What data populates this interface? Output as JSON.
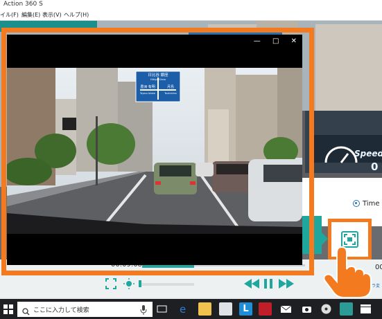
{
  "window": {
    "title": "Action 360 S"
  },
  "menu": {
    "items": [
      "イル(F)",
      "編集(E)",
      "表示(V)",
      "ヘルプ(H)"
    ]
  },
  "player": {
    "time": "00:09:08",
    "side_number": "00",
    "speed_label": "Speed",
    "speed_value": "0",
    "time_option_label": "Time",
    "small_label": "カメラ変換"
  },
  "video_window": {
    "controls": [
      "—",
      "□",
      "✕"
    ],
    "road_sign": {
      "line1": "日比谷 銀座",
      "line2": "Hibiya Ginza",
      "line3_left": "豊洲 有明",
      "line3_right": "月島",
      "line4_left": "Toyosu Ariake",
      "line4_right": "Tsukishima"
    }
  },
  "taskbar": {
    "search_placeholder": "ここに入力して検索"
  },
  "colors": {
    "accent": "#1fa79e",
    "highlight": "#f47a20",
    "brand_blue": "#2471b8"
  }
}
